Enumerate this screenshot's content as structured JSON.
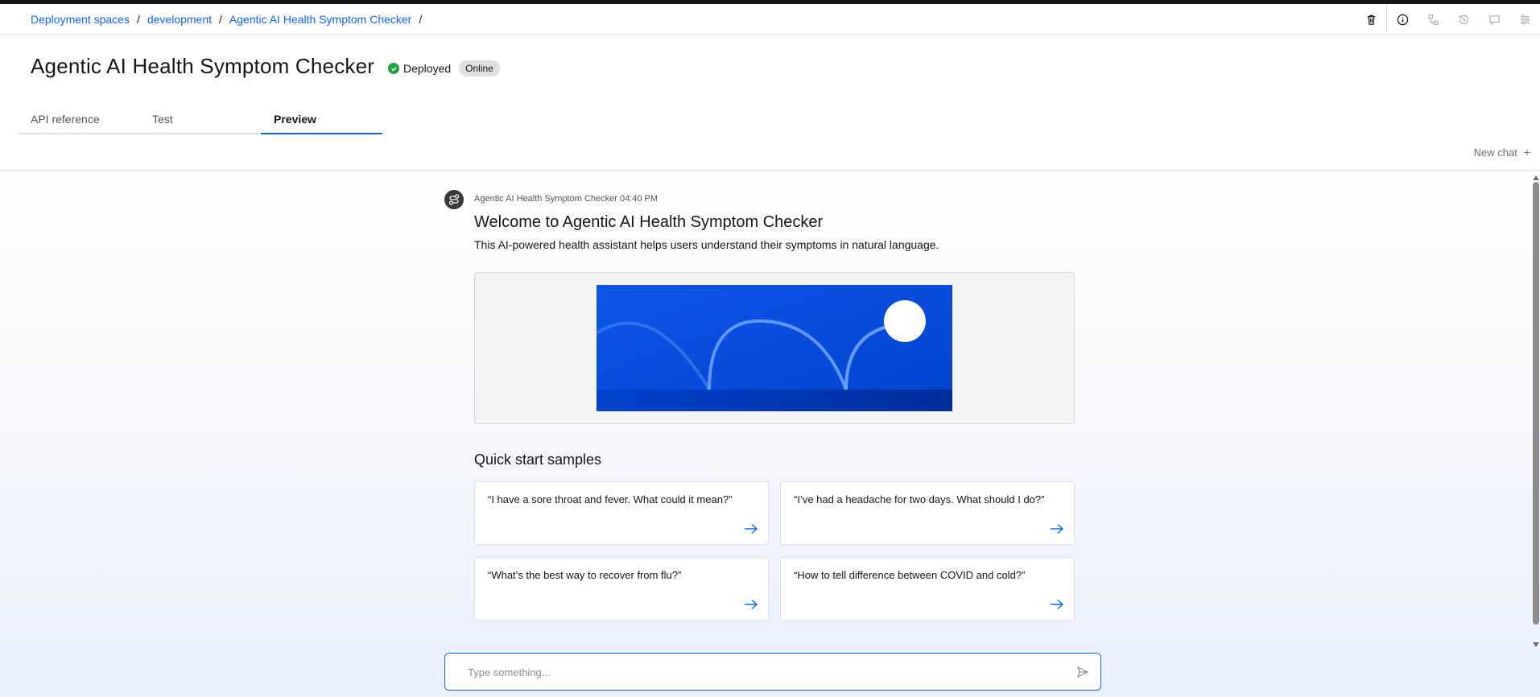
{
  "breadcrumb": {
    "items": [
      "Deployment spaces",
      "development",
      "Agentic AI Health Symptom Checker"
    ],
    "separator": "/"
  },
  "toolbar": {
    "icons": [
      "trash-icon",
      "info-icon",
      "diagram-icon",
      "history-icon",
      "chat-icon",
      "settings-icon"
    ]
  },
  "header": {
    "title": "Agentic AI Health Symptom Checker",
    "status_label": "Deployed",
    "status_color": "#24a148",
    "tag": "Online"
  },
  "tabs": [
    {
      "label": "API reference",
      "active": false
    },
    {
      "label": "Test",
      "active": false
    },
    {
      "label": "Preview",
      "active": true
    }
  ],
  "chat": {
    "new_chat_label": "New chat",
    "message": {
      "meta": "Agentic AI Health Symptom Checker 04:40 PM",
      "title": "Welcome to Agentic AI Health Symptom Checker",
      "description": "This AI-powered health assistant helps users understand their symptoms in natural language."
    },
    "samples_title": "Quick start samples",
    "samples": [
      "“I have a sore throat and fever. What could it mean?”",
      "“I’ve had a headache for two days. What should I do?”",
      "“What’s the best way to recover from flu?”",
      "“How to tell difference between COVID and cold?”"
    ],
    "input": {
      "placeholder": "Type something...",
      "value": ""
    }
  },
  "colors": {
    "accent": "#0f62fe",
    "hero_blue": "#0043ce"
  }
}
